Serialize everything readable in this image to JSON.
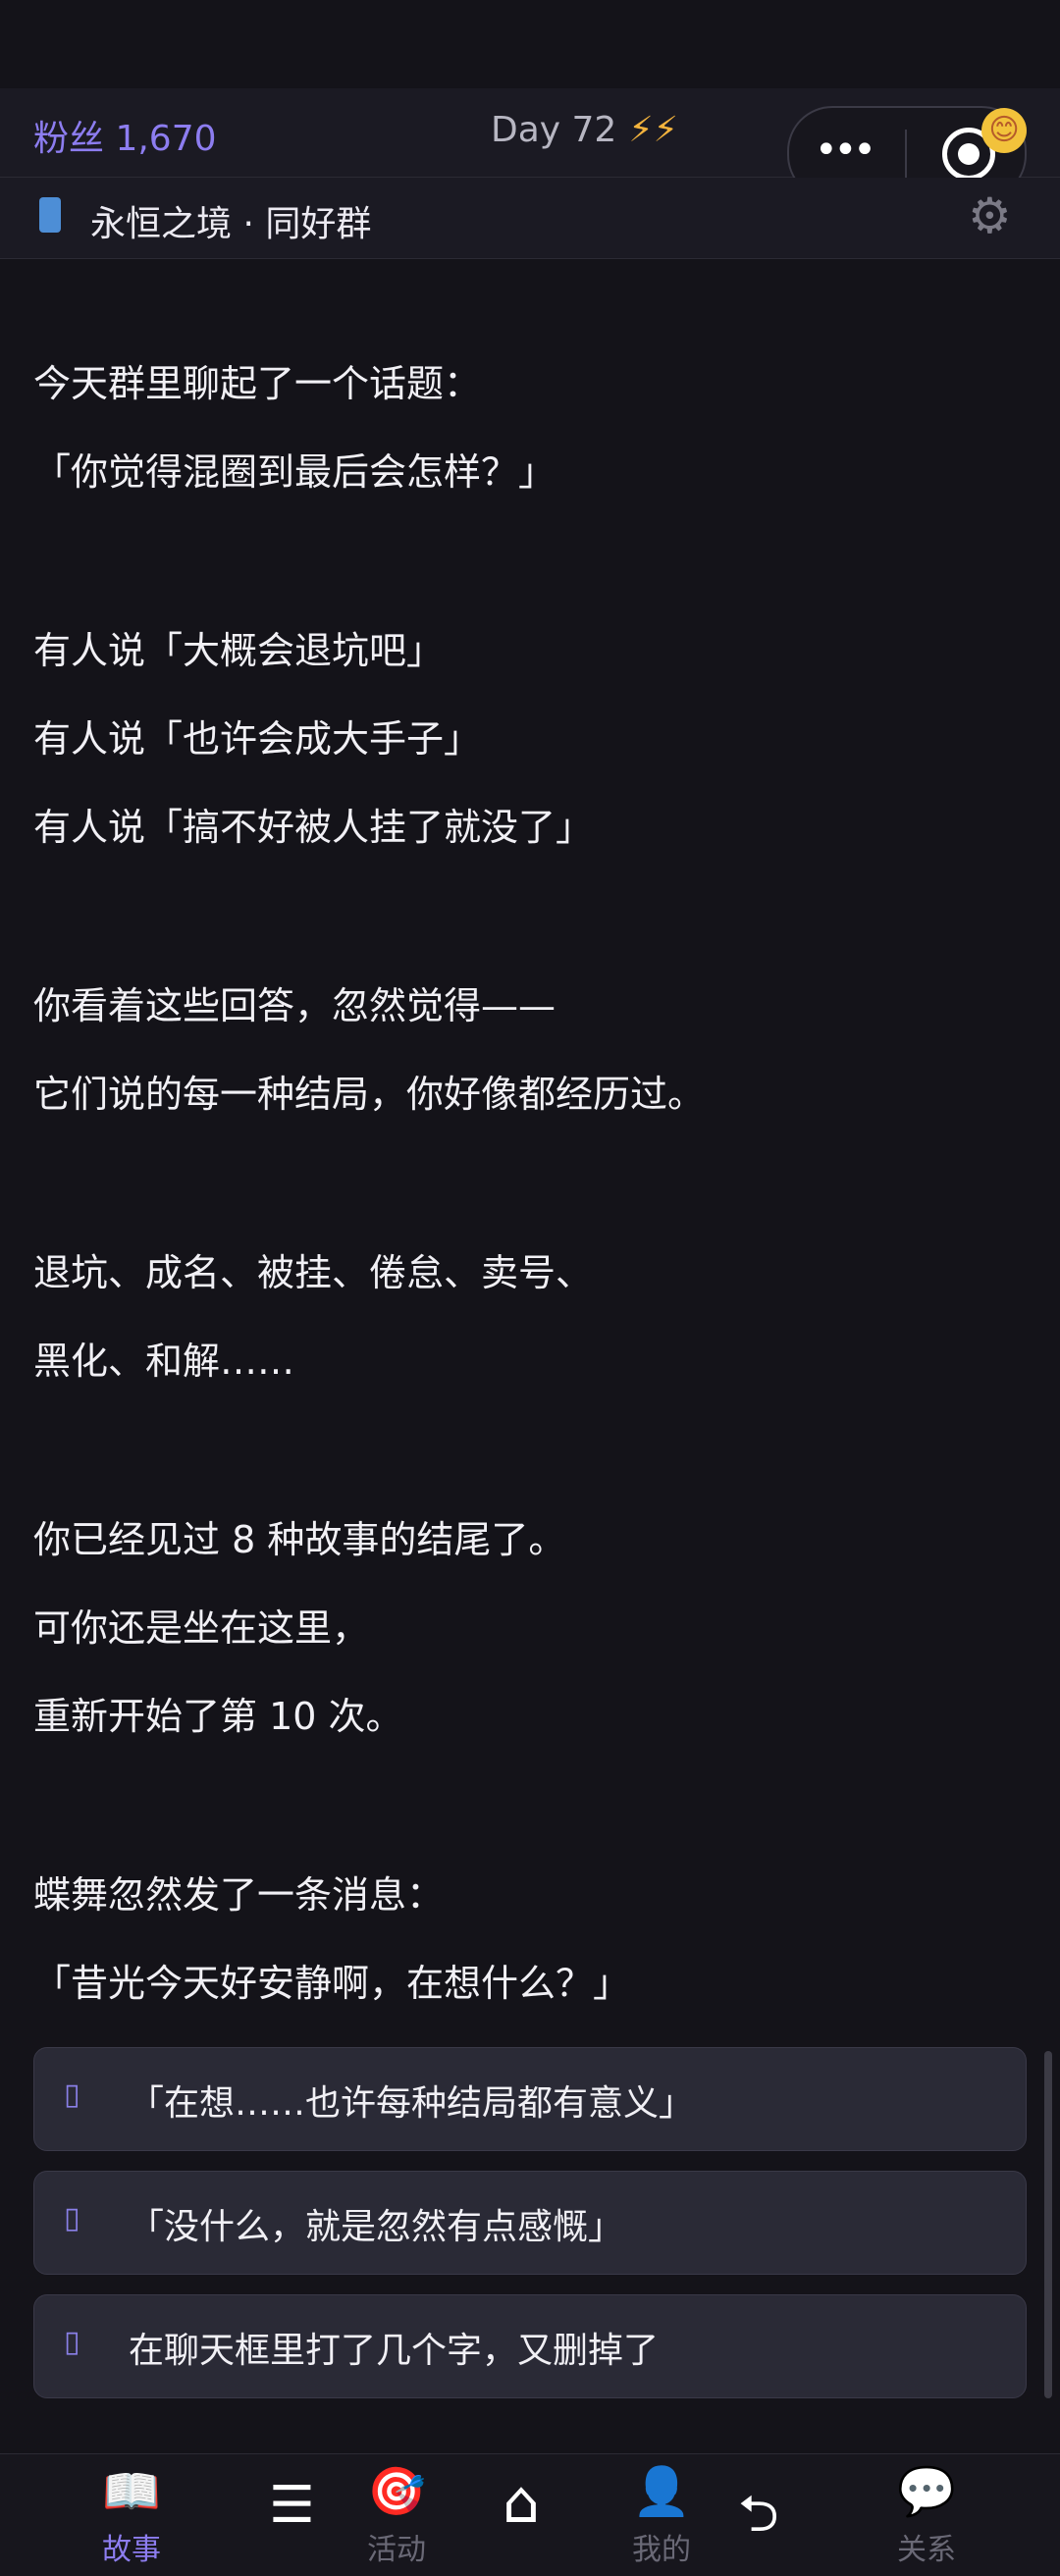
{
  "header": {
    "fans": "粉丝 1,670",
    "day": "Day 72",
    "bolts": "⚡⚡"
  },
  "capsule": {
    "more_glyph": "•••",
    "emoji": "😊"
  },
  "group": {
    "title": "永恒之境 · 同好群"
  },
  "story": {
    "lines": [
      "今天群里聊起了一个话题：",
      "「你觉得混圈到最后会怎样？」",
      "有人说「大概会退坑吧」",
      "有人说「也许会成大手子」",
      "有人说「搞不好被人挂了就没了」",
      "你看着这些回答，忽然觉得——",
      "它们说的每一种结局，你好像都经历过。",
      "退坑、成名、被挂、倦怠、卖号、",
      "黑化、和解……",
      "你已经见过 8 种故事的结尾了。",
      "可你还是坐在这里，",
      "重新开始了第 10 次。",
      "蝶舞忽然发了一条消息：",
      "「昔光今天好安静啊，在想什么？」"
    ]
  },
  "choices": [
    {
      "icon": "▯",
      "label": "「在想……也许每种结局都有意义」"
    },
    {
      "icon": "▯",
      "label": "「没什么，就是忽然有点感慨」"
    },
    {
      "icon": "▯",
      "label": "在聊天框里打了几个字，又删掉了"
    }
  ],
  "nav": {
    "story": {
      "icon": "📖",
      "label": "故事"
    },
    "menu": {
      "icon": "☰"
    },
    "activity": {
      "icon": "🎯",
      "label": "活动"
    },
    "home": {
      "icon": "⌂"
    },
    "mine": {
      "icon": "👤",
      "label": "我的"
    },
    "back": {
      "icon": "⮌"
    },
    "relation": {
      "icon": "💬",
      "label": "关系"
    }
  },
  "colors": {
    "accent": "#8d7df0",
    "background": "#141319",
    "bolt": "#f3b33d"
  }
}
